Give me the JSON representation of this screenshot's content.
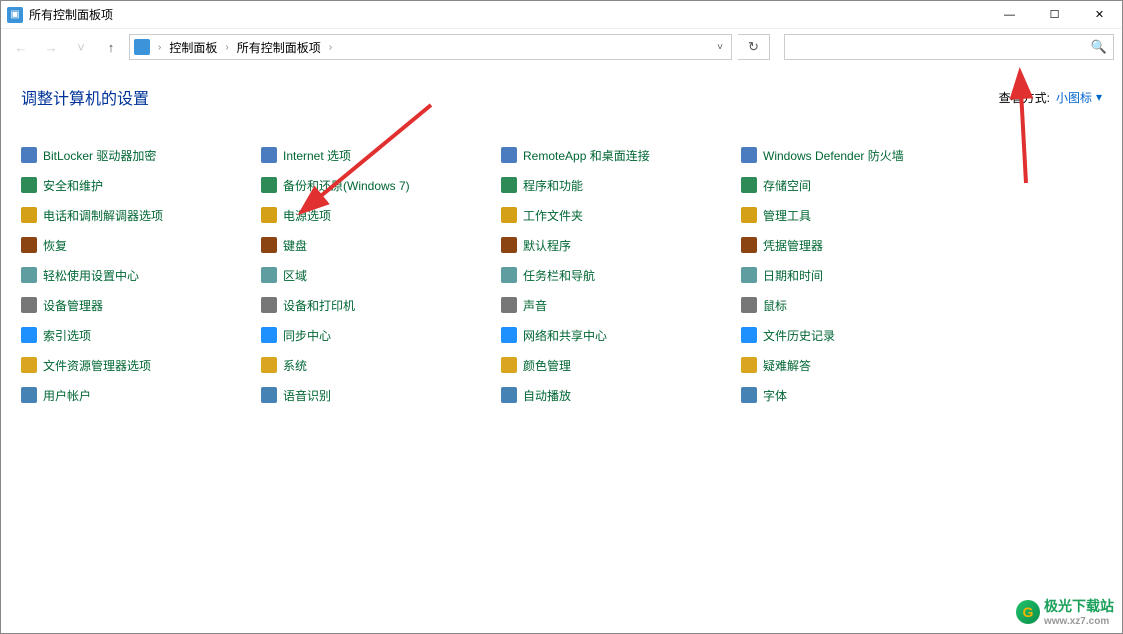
{
  "window": {
    "title": "所有控制面板项"
  },
  "buttons": {
    "minimize": "—",
    "maximize": "☐",
    "close": "✕"
  },
  "nav": {
    "back": "←",
    "forward": "→",
    "up": "↑",
    "refresh": "↻"
  },
  "breadcrumb": {
    "root": "控制面板",
    "current": "所有控制面板项"
  },
  "search": {
    "placeholder": ""
  },
  "heading": "调整计算机的设置",
  "view": {
    "label": "查看方式:",
    "value": "小图标"
  },
  "items": {
    "col1": [
      {
        "icon": "c1",
        "name": "bitlocker",
        "label": "BitLocker 驱动器加密"
      },
      {
        "icon": "c2",
        "name": "security",
        "label": "安全和维护"
      },
      {
        "icon": "c3",
        "name": "phone-modem",
        "label": "电话和调制解调器选项"
      },
      {
        "icon": "c4",
        "name": "recovery",
        "label": "恢复"
      },
      {
        "icon": "c5",
        "name": "ease-access",
        "label": "轻松使用设置中心"
      },
      {
        "icon": "c6",
        "name": "device-mgr",
        "label": "设备管理器"
      },
      {
        "icon": "c7",
        "name": "indexing",
        "label": "索引选项"
      },
      {
        "icon": "c8",
        "name": "explorer-opts",
        "label": "文件资源管理器选项"
      },
      {
        "icon": "c9",
        "name": "user-accounts",
        "label": "用户帐户"
      }
    ],
    "col2": [
      {
        "icon": "c1",
        "name": "internet-opts",
        "label": "Internet 选项"
      },
      {
        "icon": "c2",
        "name": "backup-restore",
        "label": "备份和还原(Windows 7)"
      },
      {
        "icon": "c3",
        "name": "power-opts",
        "label": "电源选项"
      },
      {
        "icon": "c4",
        "name": "keyboard",
        "label": "键盘"
      },
      {
        "icon": "c5",
        "name": "region",
        "label": "区域"
      },
      {
        "icon": "c6",
        "name": "devices-printers",
        "label": "设备和打印机"
      },
      {
        "icon": "c7",
        "name": "sync-center",
        "label": "同步中心"
      },
      {
        "icon": "c8",
        "name": "system",
        "label": "系统"
      },
      {
        "icon": "c9",
        "name": "speech",
        "label": "语音识别"
      }
    ],
    "col3": [
      {
        "icon": "c1",
        "name": "remoteapp",
        "label": "RemoteApp 和桌面连接"
      },
      {
        "icon": "c2",
        "name": "programs",
        "label": "程序和功能"
      },
      {
        "icon": "c3",
        "name": "work-folders",
        "label": "工作文件夹"
      },
      {
        "icon": "c4",
        "name": "default-programs",
        "label": "默认程序"
      },
      {
        "icon": "c5",
        "name": "taskbar-nav",
        "label": "任务栏和导航"
      },
      {
        "icon": "c6",
        "name": "sound",
        "label": "声音"
      },
      {
        "icon": "c7",
        "name": "network-sharing",
        "label": "网络和共享中心"
      },
      {
        "icon": "c8",
        "name": "color-mgmt",
        "label": "颜色管理"
      },
      {
        "icon": "c9",
        "name": "autoplay",
        "label": "自动播放"
      }
    ],
    "col4": [
      {
        "icon": "c1",
        "name": "defender-firewall",
        "label": "Windows Defender 防火墙"
      },
      {
        "icon": "c2",
        "name": "storage-spaces",
        "label": "存储空间"
      },
      {
        "icon": "c3",
        "name": "admin-tools",
        "label": "管理工具"
      },
      {
        "icon": "c4",
        "name": "credential-mgr",
        "label": "凭据管理器"
      },
      {
        "icon": "c5",
        "name": "date-time",
        "label": "日期和时间"
      },
      {
        "icon": "c6",
        "name": "mouse",
        "label": "鼠标"
      },
      {
        "icon": "c7",
        "name": "file-history",
        "label": "文件历史记录"
      },
      {
        "icon": "c8",
        "name": "troubleshoot",
        "label": "疑难解答"
      },
      {
        "icon": "c9",
        "name": "fonts",
        "label": "字体"
      }
    ]
  },
  "watermark": {
    "name": "极光下载站",
    "url": "www.xz7.com"
  }
}
